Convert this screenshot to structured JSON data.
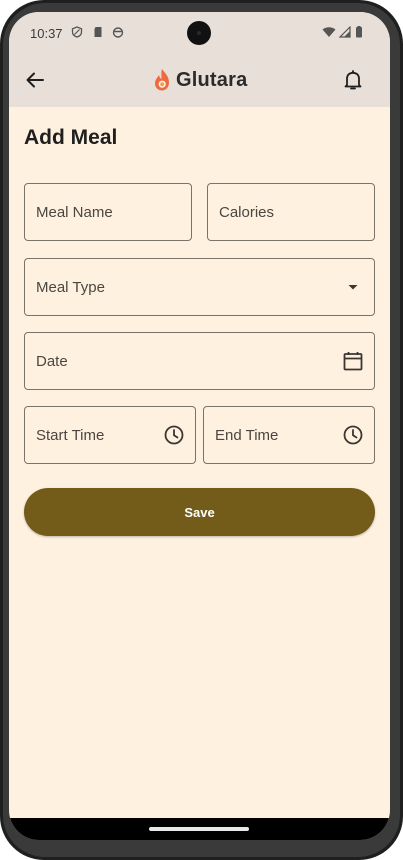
{
  "status_bar": {
    "time": "10:37"
  },
  "app_bar": {
    "brand": "Glutara",
    "colors": {
      "bar": "#e8e0d8",
      "flame_outer": "#ee6a41",
      "flame_inner": "#f6a04d"
    }
  },
  "page": {
    "title": "Add Meal",
    "background": "#fff1e0"
  },
  "form": {
    "meal_name": {
      "label": "Meal Name"
    },
    "calories": {
      "label": "Calories"
    },
    "meal_type": {
      "label": "Meal Type"
    },
    "date": {
      "label": "Date"
    },
    "start_time": {
      "label": "Start Time"
    },
    "end_time": {
      "label": "End Time"
    },
    "save_label": "Save",
    "save_color": "#735c19"
  },
  "icons": [
    "back-arrow-icon",
    "bell-icon",
    "dropdown-arrow-icon",
    "calendar-icon",
    "clock-icon"
  ]
}
